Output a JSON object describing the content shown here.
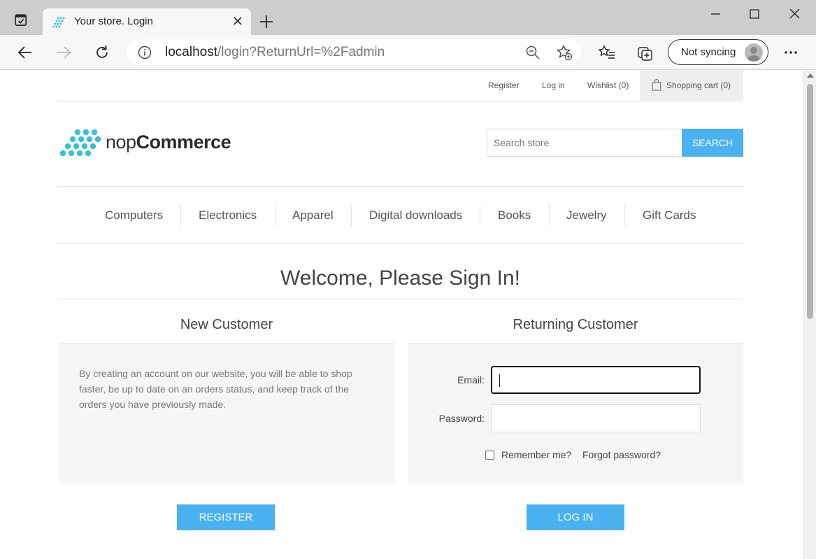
{
  "browser": {
    "tab_title": "Your store. Login",
    "url_host": "localhost",
    "url_path": "/login?ReturnUrl=%2Fadmin",
    "sync_label": "Not syncing"
  },
  "header": {
    "register": "Register",
    "login": "Log in",
    "wishlist": "Wishlist (0)",
    "cart": "Shopping cart (0)"
  },
  "logo": {
    "prefix": "nop",
    "suffix": "Commerce"
  },
  "search": {
    "placeholder": "Search store",
    "button": "SEARCH"
  },
  "menu": [
    "Computers",
    "Electronics",
    "Apparel",
    "Digital downloads",
    "Books",
    "Jewelry",
    "Gift Cards"
  ],
  "page": {
    "title": "Welcome, Please Sign In!"
  },
  "new_customer": {
    "title": "New Customer",
    "text": "By creating an account on our website, you will be able to shop faster, be up to date on an orders status, and keep track of the orders you have previously made.",
    "button": "REGISTER"
  },
  "returning_customer": {
    "title": "Returning Customer",
    "email_label": "Email:",
    "email_value": "",
    "password_label": "Password:",
    "password_value": "",
    "remember": "Remember me?",
    "forgot": "Forgot password?",
    "button": "LOG IN"
  },
  "colors": {
    "accent": "#4ab2f1",
    "logo_dots": "#39c0d8"
  }
}
